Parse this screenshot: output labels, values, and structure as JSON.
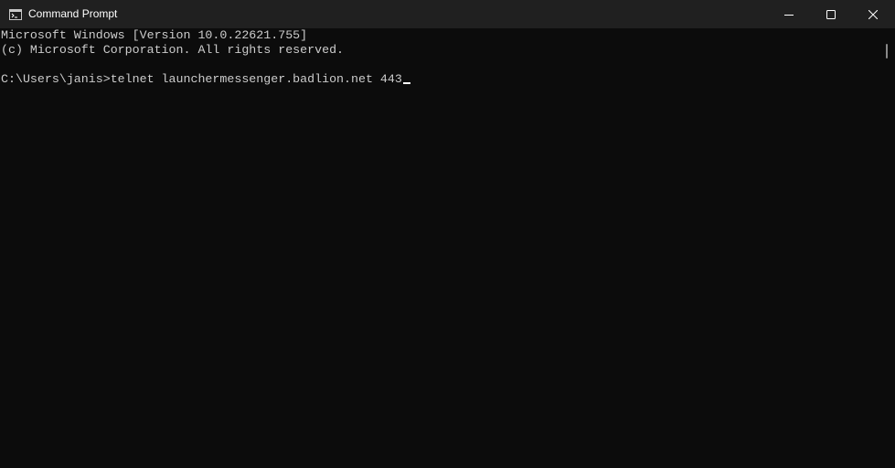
{
  "window": {
    "title": "Command Prompt",
    "icon": "cmd-icon"
  },
  "controls": {
    "minimize": "minimize-icon",
    "maximize": "maximize-icon",
    "close": "close-icon"
  },
  "console": {
    "lines": [
      "Microsoft Windows [Version 10.0.22621.755]",
      "(c) Microsoft Corporation. All rights reserved.",
      "",
      "C:\\Users\\janis>telnet launchermessenger.badlion.net 443"
    ]
  },
  "colors": {
    "background": "#0c0c0c",
    "titlebar": "#202020",
    "text": "#cccccc"
  }
}
